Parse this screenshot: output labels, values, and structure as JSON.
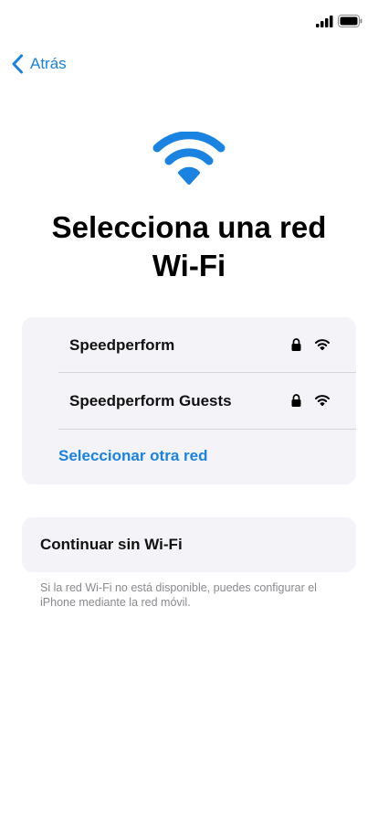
{
  "status_bar": {
    "signal_icon": "cellular-signal-icon",
    "battery_icon": "battery-icon"
  },
  "nav": {
    "back_label": "Atrás",
    "back_icon": "chevron-left-icon"
  },
  "hero": {
    "icon": "wifi-icon",
    "accent_color": "#1a82e0"
  },
  "title": "Selecciona una red Wi-Fi",
  "networks": [
    {
      "name": "Speedperform",
      "secured": true,
      "signal_icon": "wifi-signal-icon"
    },
    {
      "name": "Speedperform Guests",
      "secured": true,
      "signal_icon": "wifi-signal-icon"
    }
  ],
  "other_network_label": "Seleccionar otra red",
  "continue_without_wifi_label": "Continuar sin Wi-Fi",
  "footnote": "Si la red Wi-Fi no está disponible, puedes configurar el iPhone mediante la red móvil.",
  "colors": {
    "accent": "#1a82e0",
    "card_background": "#f3f3f8",
    "secondary_text": "#8a8a8e"
  }
}
